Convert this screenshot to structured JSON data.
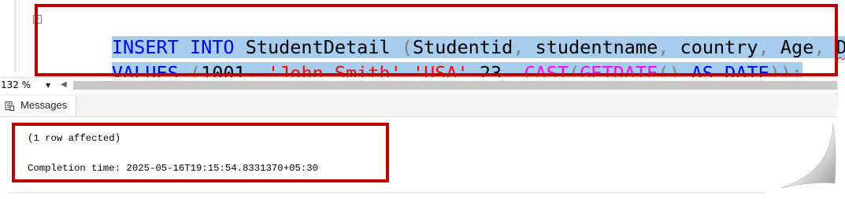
{
  "editor": {
    "collapse_glyph": "−",
    "line1": [
      {
        "t": "INSERT",
        "c": "kw"
      },
      {
        "t": " ",
        "c": "id"
      },
      {
        "t": "INTO",
        "c": "kw"
      },
      {
        "t": " ",
        "c": "id"
      },
      {
        "t": "StudentDetail",
        "c": "id"
      },
      {
        "t": " ",
        "c": "id"
      },
      {
        "t": "(",
        "c": "gr"
      },
      {
        "t": "Studentid",
        "c": "id"
      },
      {
        "t": ",",
        "c": "gr"
      },
      {
        "t": " ",
        "c": "id"
      },
      {
        "t": "studentname",
        "c": "id"
      },
      {
        "t": ",",
        "c": "gr"
      },
      {
        "t": " ",
        "c": "id"
      },
      {
        "t": "country",
        "c": "id"
      },
      {
        "t": ",",
        "c": "gr"
      },
      {
        "t": " ",
        "c": "id"
      },
      {
        "t": "Age",
        "c": "id"
      },
      {
        "t": ",",
        "c": "gr"
      },
      {
        "t": " ",
        "c": "id"
      },
      {
        "t": "DOB",
        "c": "id squiggle"
      },
      {
        "t": ")",
        "c": "gr"
      }
    ],
    "line2": [
      {
        "t": "VALUES",
        "c": "kw"
      },
      {
        "t": " ",
        "c": "id"
      },
      {
        "t": "(",
        "c": "gr"
      },
      {
        "t": "1001",
        "c": "num"
      },
      {
        "t": ",",
        "c": "gr"
      },
      {
        "t": " ",
        "c": "id"
      },
      {
        "t": "'John Smith'",
        "c": "str"
      },
      {
        "t": ",",
        "c": "gr"
      },
      {
        "t": "'USA'",
        "c": "str"
      },
      {
        "t": ",",
        "c": "gr"
      },
      {
        "t": "23",
        "c": "num"
      },
      {
        "t": ",",
        "c": "gr"
      },
      {
        "t": " ",
        "c": "id"
      },
      {
        "t": "CAST",
        "c": "fn"
      },
      {
        "t": "(",
        "c": "gr"
      },
      {
        "t": "GETDATE",
        "c": "fn"
      },
      {
        "t": "()",
        "c": "gr"
      },
      {
        "t": " ",
        "c": "id"
      },
      {
        "t": "AS",
        "c": "kw"
      },
      {
        "t": " ",
        "c": "id"
      },
      {
        "t": "DATE",
        "c": "kw"
      },
      {
        "t": "));",
        "c": "gr"
      }
    ]
  },
  "statusbar": {
    "zoom": "132 %",
    "zoom_dropdown": "▼",
    "scroll_left": "◀"
  },
  "results": {
    "tab_label": "Messages",
    "lines": [
      "(1 row affected)",
      "Completion time: 2025-05-16T19:15:54.8331370+05:30"
    ]
  },
  "colors": {
    "keyword": "#0000ff",
    "string": "#ff0000",
    "function": "#ff00ff",
    "punctuation": "#808080",
    "selection": "#a6ccee",
    "highlight_box": "#c00000"
  }
}
